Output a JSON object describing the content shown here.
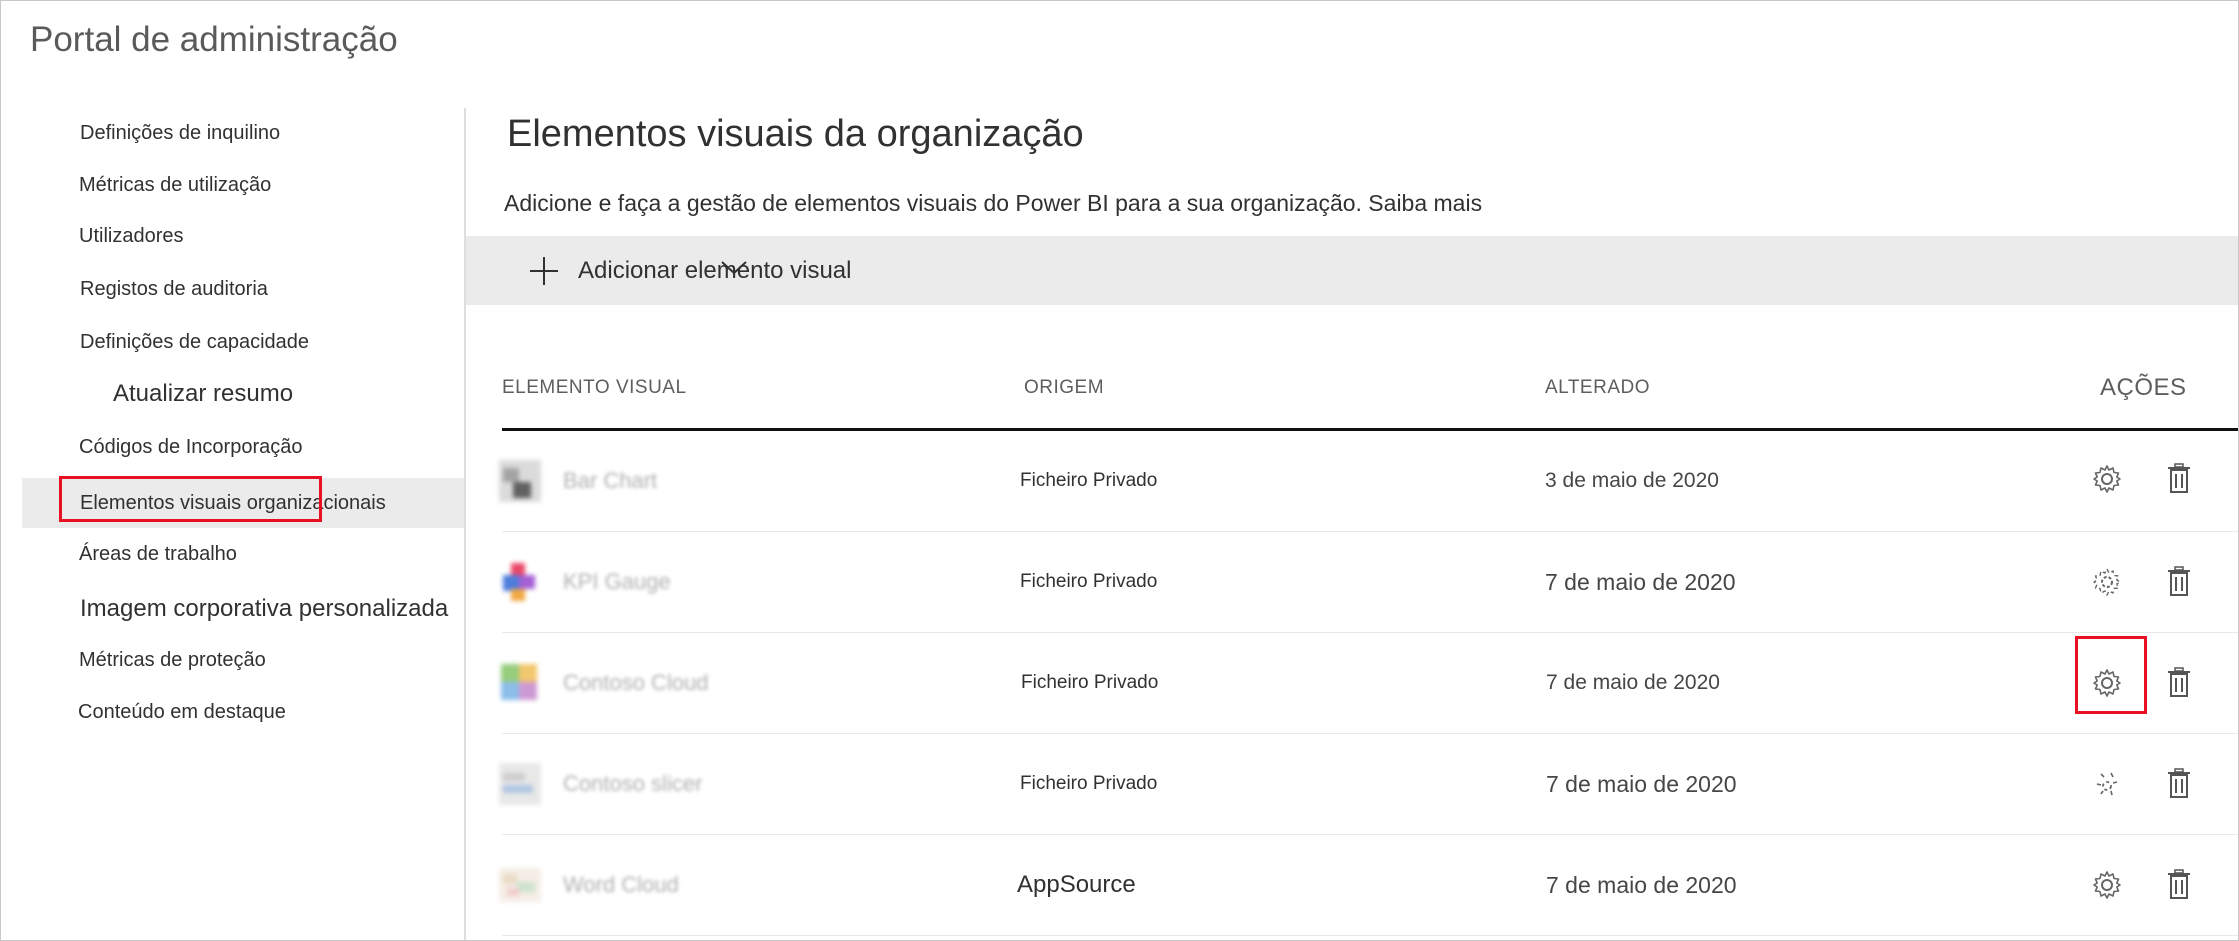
{
  "portal": {
    "title": "Portal de administração"
  },
  "sidebar": {
    "items": [
      {
        "label": "Definições de inquilino"
      },
      {
        "label": "Métricas de utilização"
      },
      {
        "label": "Utilizadores"
      },
      {
        "label": "Registos de auditoria"
      },
      {
        "label": "Definições de capacidade"
      },
      {
        "label": "Atualizar resumo"
      },
      {
        "label": "Códigos de Incorporação"
      },
      {
        "label": "Elementos visuais organizacionais",
        "selected": true
      },
      {
        "label": "Áreas de trabalho"
      },
      {
        "label": "Imagem corporativa personalizada"
      },
      {
        "label": "Métricas de proteção"
      },
      {
        "label": "Conteúdo em destaque"
      }
    ]
  },
  "main": {
    "title": "Elementos visuais da organização",
    "description": "Adicione e faça a gestão de elementos visuais do Power BI para a sua organização. Saiba mais",
    "toolbar": {
      "add_label": "Adicionar elemento visual",
      "add_icon": "plus-icon"
    },
    "table": {
      "headers": {
        "visual": "ELEMENTO VISUAL",
        "origin": "ORIGEM",
        "changed": "ALTERADO",
        "actions": "AÇÕES"
      },
      "rows": [
        {
          "name": "Bar Chart",
          "origin": "Ficheiro Privado",
          "changed": "3 de maio de 2020",
          "icon_colors": [
            "#9a9a9a",
            "#d8d8d8",
            "#505050"
          ]
        },
        {
          "name": "KPI Gauge",
          "origin": "Ficheiro Privado",
          "changed": "7 de maio de 2020",
          "icon_colors": [
            "#e8355a",
            "#3b6fd9",
            "#f0a030",
            "#9b4fd0"
          ]
        },
        {
          "name": "Contoso Cloud",
          "origin": "Ficheiro Privado",
          "changed": "7 de maio de 2020",
          "icon_colors": [
            "#8cc870",
            "#f2c15e",
            "#c88fd0",
            "#7fb7e8"
          ]
        },
        {
          "name": "Contoso slicer",
          "origin": "Ficheiro Privado",
          "changed": "7 de maio de 2020",
          "icon_colors": [
            "#c8c8c8",
            "#e6e6e6",
            "#a8c0e0"
          ]
        },
        {
          "name": "Word Cloud",
          "origin": "AppSource",
          "changed": "7 de maio de 2020",
          "icon_colors": [
            "#e8d7c0",
            "#c8e0c8",
            "#f0c8c8"
          ]
        }
      ],
      "action_icons": {
        "settings": "gear-icon",
        "delete": "trash-icon"
      }
    }
  },
  "colors": {
    "highlight": "#e81123",
    "toolbar_bg": "#ebebeb",
    "selected_bg": "#ebebeb"
  }
}
